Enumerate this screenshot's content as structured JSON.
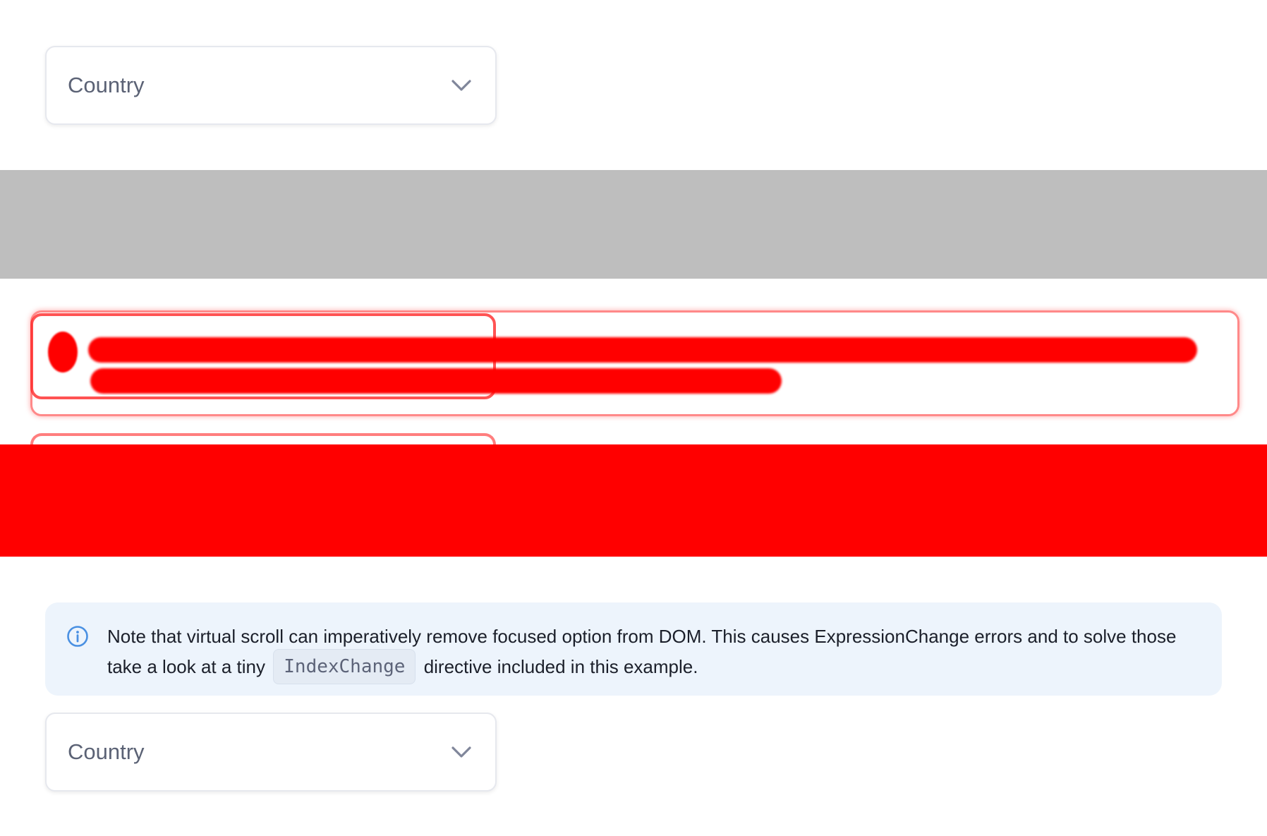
{
  "top_select": {
    "placeholder": "Country"
  },
  "notice": {
    "text_before": "Note that virtual scroll can imperatively remove focused option from DOM. This causes ExpressionChange errors and to solve those take a look at a tiny",
    "code": "IndexChange",
    "text_after": "directive included in this example."
  },
  "bottom_select": {
    "placeholder": "Country"
  },
  "colors": {
    "gray_band": "#bebebe",
    "red_band": "#ff0000",
    "notice_bg": "#edf4fc",
    "info_icon": "#4a90e2",
    "select_text": "#5b6275"
  },
  "icons": {
    "select_chevron": "chevron-down-icon",
    "notice_icon": "info-icon"
  }
}
